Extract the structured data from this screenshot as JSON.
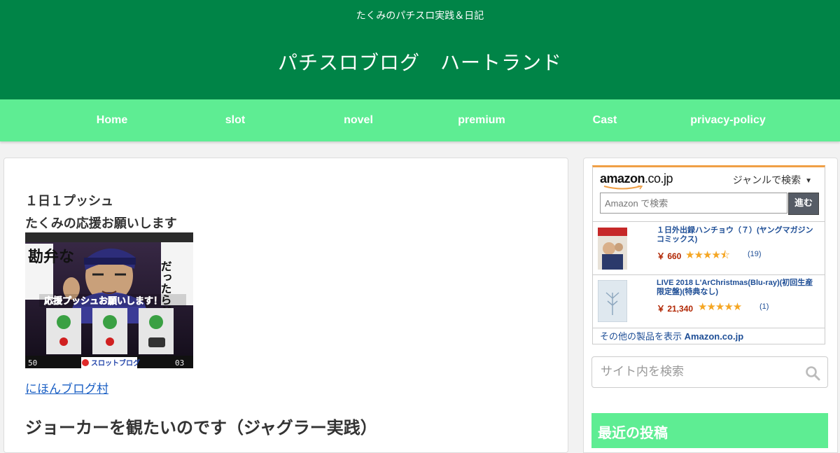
{
  "header": {
    "tagline": "たくみのパチスロ実践＆日記",
    "site_title": "パチスロブログ　ハートランド"
  },
  "nav": {
    "items": [
      {
        "label": "Home"
      },
      {
        "label": "slot"
      },
      {
        "label": "novel"
      },
      {
        "label": "premium"
      },
      {
        "label": "Cast"
      },
      {
        "label": "privacy-policy"
      }
    ]
  },
  "main": {
    "banner_line1": "１日１プッシュ",
    "banner_line2": "たくみの応援お願いします",
    "banner_image": {
      "side_text_left": "勘弁な",
      "side_text_right": "だったらジャグラー",
      "caption": "応援プッシュお願いします！",
      "badge": "スロットブログ",
      "counter_left": "50",
      "counter_right": "03"
    },
    "village_link": "にほんブログ村",
    "entry_title": "ジョーカーを観たいのです（ジャグラー実践）"
  },
  "sidebar": {
    "amazon": {
      "logo_text": "amazon",
      "logo_tld": ".co.jp",
      "genre_label": "ジャンルで検索",
      "search_placeholder": "Amazon で検索",
      "go_label": "進む",
      "products": [
        {
          "title": "１日外出録ハンチョウ（７）(ヤングマガジンコミックス)",
          "price": "￥ 660",
          "stars": "★★★★⯪",
          "rating": 4.5,
          "count": "(19)"
        },
        {
          "title": "LIVE 2018 L'ArChristmas(Blu-ray)(初回生産限定盤)(特典なし)",
          "price": "￥ 21,340",
          "stars": "★★★★★",
          "rating": 5,
          "count": "(1)"
        }
      ],
      "footer_prefix": "その他の製品を表示",
      "footer_store": "Amazon.co.jp"
    },
    "site_search_placeholder": "サイト内を検索",
    "recent_posts_title": "最近の投稿"
  },
  "colors": {
    "header_bg": "#008447",
    "nav_bg": "#5eed93",
    "link": "#1a5fc4",
    "amazon_accent": "#f0a046",
    "price": "#b12704"
  }
}
